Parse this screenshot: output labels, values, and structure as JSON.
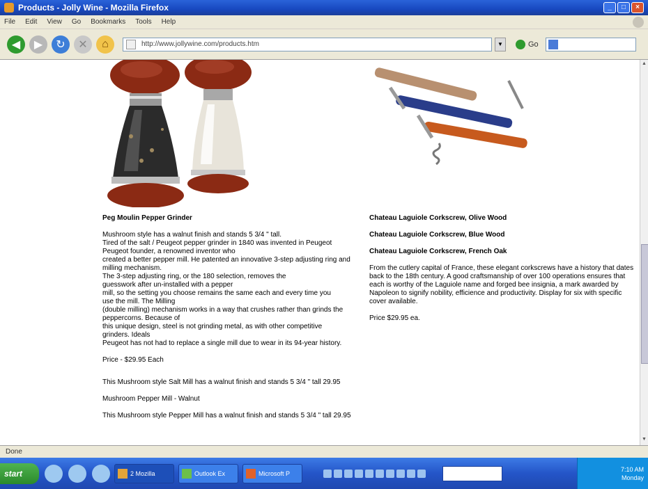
{
  "window": {
    "title": "Products - Jolly Wine - Mozilla Firefox"
  },
  "menu": [
    "File",
    "Edit",
    "View",
    "Go",
    "Bookmarks",
    "Tools",
    "Help"
  ],
  "navbar": {
    "url": "http://www.jollywine.com/products.htm",
    "go_label": "Go",
    "search_label": "G"
  },
  "left_product": {
    "title": "Peg Moulin Pepper Grinder",
    "lines": [
      "Mushroom style has a walnut finish and stands 5 3/4 \" tall.",
      "Tired of the salt / Peugeot pepper grinder in 1840 was invented in Peugeot",
      "Peugeot founder, a renowned inventor who",
      "created a better pepper mill. He patented an innovative 3-step adjusting ring and",
      "milling mechanism.",
      "The 3-step adjusting ring, or the 180 selection, removes the",
      "guesswork after un-installed with a pepper",
      "mill, so the setting you choose remains the same each and every time you",
      "use the mill. The Milling",
      "(double milling) mechanism works in a way that crushes rather than grinds the",
      "peppercorns. Because of",
      "this unique design, steel is not grinding metal, as with other competitive",
      "grinders. Ideals",
      "Peugeot has not had to replace a single mill due to wear in its 94-year history."
    ],
    "price": "Price - $29.95 Each",
    "extra1": "This Mushroom style Salt Mill has a walnut finish and stands 5 3/4 \" tall 29.95",
    "extra2": "Mushroom Pepper Mill - Walnut",
    "extra3": "This Mushroom style Pepper Mill has a walnut finish and stands 5 3/4 \" tall 29.95"
  },
  "right_product": {
    "titles": [
      "Chateau Laguiole Corkscrew, Olive Wood",
      "Chateau Laguiole Corkscrew, Blue Wood",
      "Chateau Laguiole Corkscrew, French Oak"
    ],
    "description": "From the cutlery capital of France, these elegant corkscrews have a history that dates back to the 18th century. A good craftsmanship of over 100 operations ensures that each is worthy of the Laguiole name and forged bee insignia, a mark awarded by Napoleon to signify nobility, efficience and productivity. Display for six with specific cover available.",
    "price": "Price $29.95 ea."
  },
  "status": "Done",
  "taskbar": {
    "start": "start",
    "items": [
      "2 Mozilla",
      "Outlook Ex",
      "Microsoft P"
    ],
    "clock_line1": "7:10 AM",
    "clock_line2": "Monday"
  },
  "colors": {
    "titlebar": "#1848c0",
    "taskbar": "#2455c8",
    "start_green": "#2b8a2b",
    "content_bg": "#ffffff"
  }
}
